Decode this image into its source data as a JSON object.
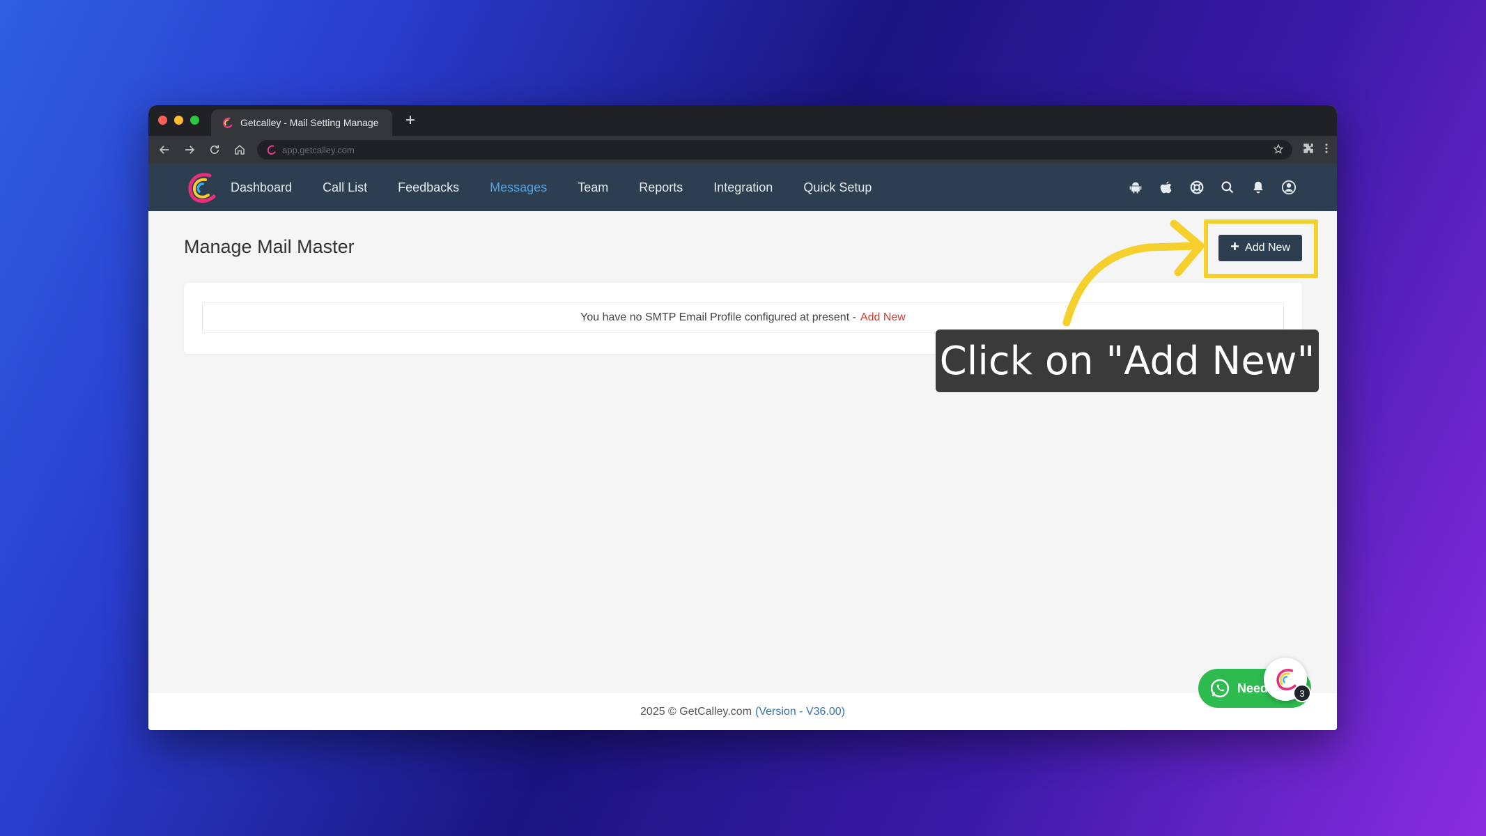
{
  "browser": {
    "tab_title": "Getcalley - Mail Setting Manage",
    "new_tab_label": "+",
    "url": "app.getcalley.com"
  },
  "nav": {
    "items": [
      {
        "label": "Dashboard",
        "active": false
      },
      {
        "label": "Call List",
        "active": false
      },
      {
        "label": "Feedbacks",
        "active": false
      },
      {
        "label": "Messages",
        "active": true
      },
      {
        "label": "Team",
        "active": false
      },
      {
        "label": "Reports",
        "active": false
      },
      {
        "label": "Integration",
        "active": false
      },
      {
        "label": "Quick Setup",
        "active": false
      }
    ],
    "icons": [
      "android-icon",
      "apple-icon",
      "support-icon",
      "search-icon",
      "bell-icon",
      "user-icon"
    ]
  },
  "page": {
    "title": "Manage Mail Master",
    "add_new_label": "Add New",
    "empty_message": "You have no SMTP Email Profile configured at present -",
    "empty_link": "Add New"
  },
  "annotation": {
    "callout_text": "Click on \"Add New\"",
    "highlight_color": "#f5cf2b"
  },
  "footer": {
    "copyright": "2025 © GetCalley.com",
    "version": "(Version - V36.00)"
  },
  "chat": {
    "whatsapp_label": "Need",
    "badge_count": "3"
  },
  "colors": {
    "nav_bg": "#2c3e50",
    "nav_active": "#4ea3e6",
    "link_red": "#d63a2b",
    "whatsapp_green": "#2dba4e"
  }
}
